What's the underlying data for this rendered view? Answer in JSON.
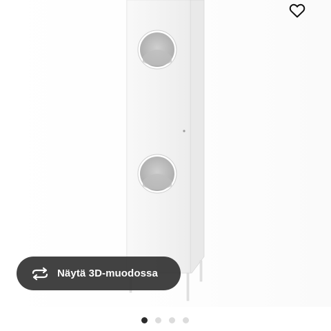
{
  "product": {
    "image_icon": "tall-cabinet-with-round-windows"
  },
  "favorite": {
    "icon": "heart-outline-icon"
  },
  "view_3d": {
    "label": "Näytä 3D-muodossa",
    "icon": "rotate-3d-icon"
  },
  "carousel": {
    "count": 4,
    "active_index": 0
  },
  "colors": {
    "button_bg": "#323232",
    "button_text": "#ffffff",
    "dot_active": "#2b2b2b",
    "dot_inactive": "#dcdcdc"
  }
}
